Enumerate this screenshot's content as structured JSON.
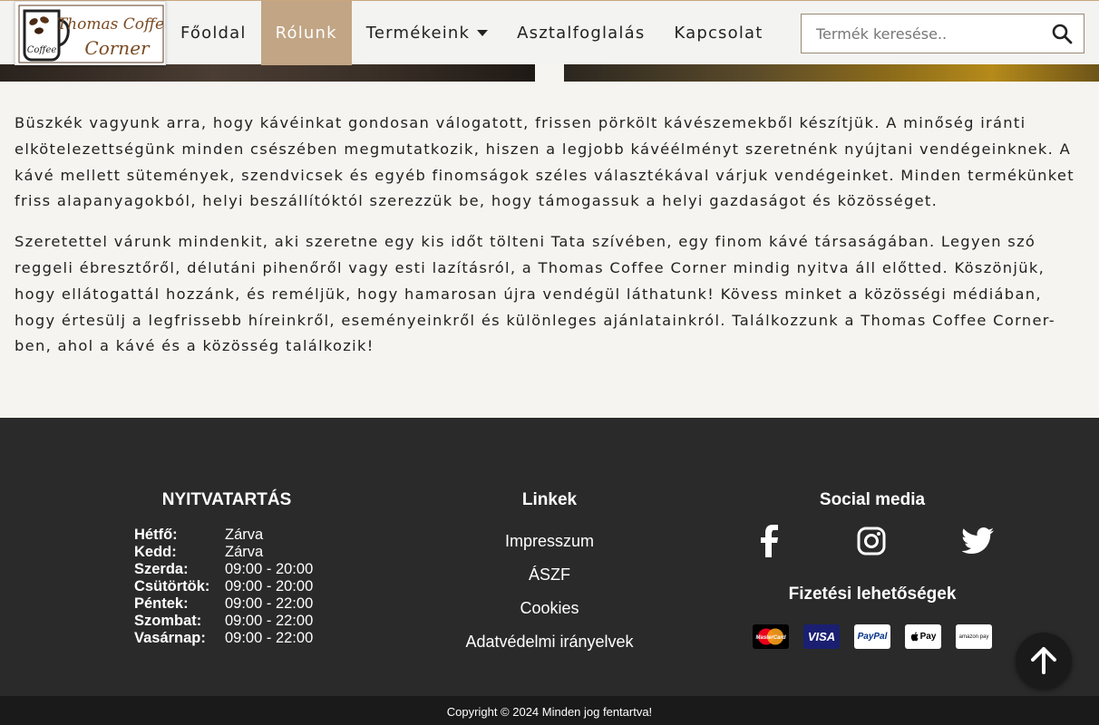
{
  "brand": {
    "logo_line1": "Thomas Coffee",
    "logo_line2": "Corner",
    "logo_cup_text": "Coffee"
  },
  "nav": {
    "items": [
      {
        "label": "Főoldal"
      },
      {
        "label": "Rólunk"
      },
      {
        "label": "Termékeink"
      },
      {
        "label": "Asztalfoglalás"
      },
      {
        "label": "Kapcsolat"
      }
    ],
    "active": "Rólunk"
  },
  "search": {
    "placeholder": "Termék keresése.."
  },
  "content": {
    "paragraphs": [
      "Büszkék vagyunk arra, hogy kávéinkat gondosan válogatott, frissen pörkölt kávészemekből készítjük. A minőség iránti elkötelezettségünk minden csészében megmutatkozik, hiszen a legjobb kávéélményt szeretnénk nyújtani vendégeinknek. A kávé mellett sütemények, szendvicsek és egyéb finomságok széles választékával várjuk vendégeinket. Minden termékünket friss alapanyagokból, helyi beszállítóktól szerezzük be, hogy támogassuk a helyi gazdaságot és közösséget.",
      "Szeretettel várunk mindenkit, aki szeretne egy kis időt tölteni Tata szívében, egy finom kávé társaságában. Legyen szó reggeli ébresztőről, délutáni pihenőről vagy esti lazításról, a Thomas Coffee Corner mindig nyitva áll előtted. Köszönjük, hogy ellátogattál hozzánk, és reméljük, hogy hamarosan újra vendégül láthatunk! Kövess minket a közösségi médiában, hogy értesülj a legfrissebb híreinkről, eseményeinkről és különleges ajánlatainkról. Találkozzunk a Thomas Coffee Corner-ben, ahol a kávé és a közösség találkozik!"
    ]
  },
  "footer": {
    "hours_title": "NYITVATARTÁS",
    "hours": [
      {
        "day": "Hétfő:",
        "time": "Zárva"
      },
      {
        "day": "Kedd:",
        "time": "Zárva"
      },
      {
        "day": "Szerda:",
        "time": "09:00 - 20:00"
      },
      {
        "day": "Csütörtök:",
        "time": "09:00 - 20:00"
      },
      {
        "day": "Péntek:",
        "time": "09:00 - 22:00"
      },
      {
        "day": "Szombat:",
        "time": "09:00 - 22:00"
      },
      {
        "day": "Vasárnap:",
        "time": "09:00 - 22:00"
      }
    ],
    "links_title": "Linkek",
    "links": [
      {
        "label": "Impresszum"
      },
      {
        "label": "ÁSZF"
      },
      {
        "label": "Cookies"
      },
      {
        "label": "Adatvédelmi irányelvek"
      }
    ],
    "social_title": "Social media",
    "social_icons": [
      "facebook-icon",
      "instagram-icon",
      "twitter-icon"
    ],
    "payment_title": "Fizetési lehetőségek",
    "payment_methods": [
      "MasterCard",
      "VISA",
      "PayPal",
      "Pay",
      "amazon pay"
    ]
  },
  "copyright": "Copyright © 2024 Minden jog fentartva!",
  "colors": {
    "accent": "#c1a584",
    "footer_bg": "#2a2a2a",
    "page_bg": "#f6f4f0"
  }
}
